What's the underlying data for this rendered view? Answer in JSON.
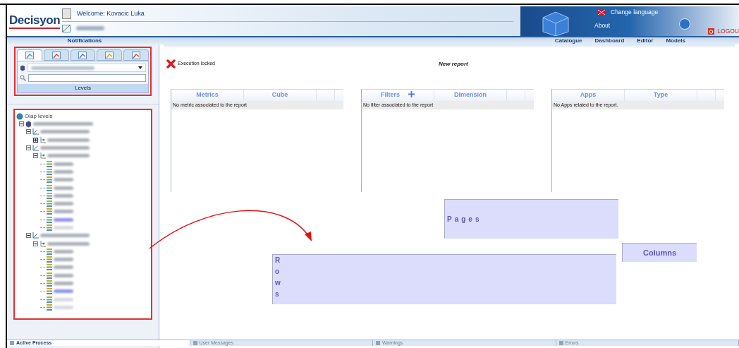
{
  "header": {
    "logo": "Decisyon",
    "welcome": "Welcome: Kovacic Luka",
    "notifications": "Notifications",
    "change_language": "Change language",
    "about": "About",
    "logout": "LOGOU"
  },
  "nav": [
    {
      "label": "Catalogue"
    },
    {
      "label": "Dashboard"
    },
    {
      "label": "Editor"
    },
    {
      "label": "Models"
    }
  ],
  "levels_panel": {
    "tabs": [
      {
        "selected": true
      },
      {
        "selected": false
      },
      {
        "selected": false
      },
      {
        "selected": false
      },
      {
        "selected": false
      }
    ],
    "title": "Levels"
  },
  "tree": {
    "title": "Olap levels",
    "nodes": [
      {
        "kind": "cube",
        "expanded": true,
        "children": [
          {
            "kind": "dimension",
            "expanded": true,
            "children": [
              {
                "kind": "hierarchy",
                "expanded": false
              }
            ]
          },
          {
            "kind": "dimension",
            "expanded": true,
            "children": [
              {
                "kind": "hierarchy",
                "expanded": true,
                "children": [
                  {
                    "kind": "level",
                    "color": "#a9aeb8"
                  },
                  {
                    "kind": "level",
                    "color": "#a9aeb8"
                  },
                  {
                    "kind": "level",
                    "color": "#a9aeb8"
                  },
                  {
                    "kind": "level",
                    "color": "#a9aeb8"
                  },
                  {
                    "kind": "level",
                    "color": "#a9aeb8"
                  },
                  {
                    "kind": "level",
                    "color": "#a9aeb8"
                  },
                  {
                    "kind": "level",
                    "color": "#a9aeb8"
                  },
                  {
                    "kind": "level",
                    "color": "#8f8fe8"
                  },
                  {
                    "kind": "level",
                    "color": "#d6d9de"
                  }
                ]
              }
            ]
          },
          {
            "kind": "dimension",
            "expanded": true,
            "children": [
              {
                "kind": "hierarchy",
                "expanded": true,
                "children": [
                  {
                    "kind": "level",
                    "color": "#a9aeb8"
                  },
                  {
                    "kind": "level",
                    "color": "#a9aeb8"
                  },
                  {
                    "kind": "level",
                    "color": "#a9aeb8"
                  },
                  {
                    "kind": "level",
                    "color": "#a9aeb8"
                  },
                  {
                    "kind": "level",
                    "color": "#a9aeb8"
                  },
                  {
                    "kind": "level",
                    "color": "#8f8fe8"
                  },
                  {
                    "kind": "level",
                    "color": "#d6d9de"
                  },
                  {
                    "kind": "level",
                    "color": "#d6d9de"
                  }
                ]
              }
            ]
          }
        ]
      }
    ]
  },
  "report": {
    "status": "Execution locked",
    "title": "New report",
    "tables": [
      {
        "columns": [
          "Metrics",
          "Cube"
        ],
        "add_button": false,
        "empty": "No metric associated to the report"
      },
      {
        "columns": [
          "Filters",
          "Dimension"
        ],
        "add_button": true,
        "empty": "No filter associated to the report"
      },
      {
        "columns": [
          "Apps",
          "Type"
        ],
        "add_button": false,
        "empty": "No Apps related to the report."
      }
    ],
    "zones": {
      "pages": "Pages",
      "rows": "Rows",
      "columns": "Columns"
    }
  },
  "status_tabs": [
    {
      "label": "Active Process",
      "selected": true
    },
    {
      "label": "User Messages",
      "selected": false
    },
    {
      "label": "Warnings",
      "selected": false
    },
    {
      "label": "Errors",
      "selected": false
    }
  ]
}
